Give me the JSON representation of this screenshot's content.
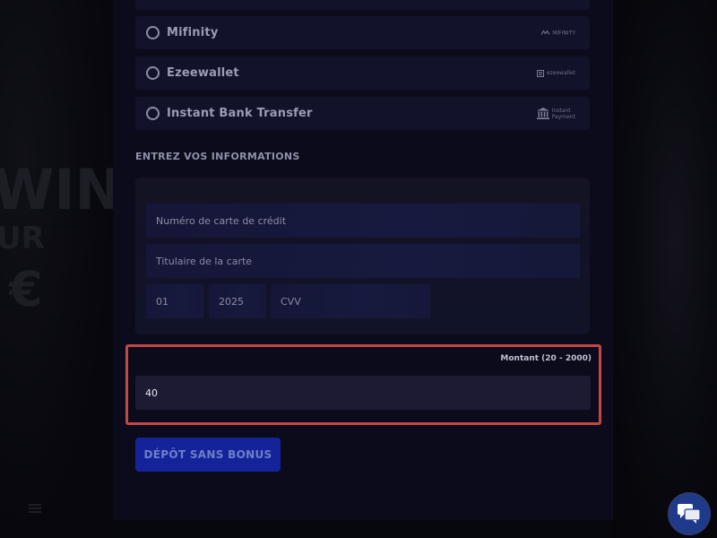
{
  "background": {
    "promo_line1": "WINS",
    "promo_line2": "UR",
    "promo_line3": "€"
  },
  "payment_methods": [
    {
      "label": "Mifinity",
      "logo_text": "MIFINITY"
    },
    {
      "label": "Ezeewallet",
      "logo_text": "ezeewallet"
    },
    {
      "label": "Instant Bank Transfer",
      "logo_text_1": "Instant",
      "logo_text_2": "Payment"
    }
  ],
  "card_section": {
    "title": "ENTREZ VOS INFORMATIONS",
    "card_number_placeholder": "Numéro de carte de crédit",
    "card_holder_placeholder": "Titulaire de la carte",
    "expiry_month": "01",
    "expiry_year": "2025",
    "cvv_placeholder": "CVV"
  },
  "amount": {
    "label": "Montant (20 - 2000)",
    "value": "40"
  },
  "deposit_button": {
    "label": "DÉPÔT SANS BONUS"
  },
  "colors": {
    "highlight_border": "#c54644",
    "button_bg": "#14239a",
    "modal_bg": "#0b0b1c",
    "chat_bg": "#1f3a8a"
  },
  "icons": [
    "radio-circle",
    "mifinity-logo",
    "ezeewallet-logo",
    "bank-icon",
    "chat-icon"
  ]
}
